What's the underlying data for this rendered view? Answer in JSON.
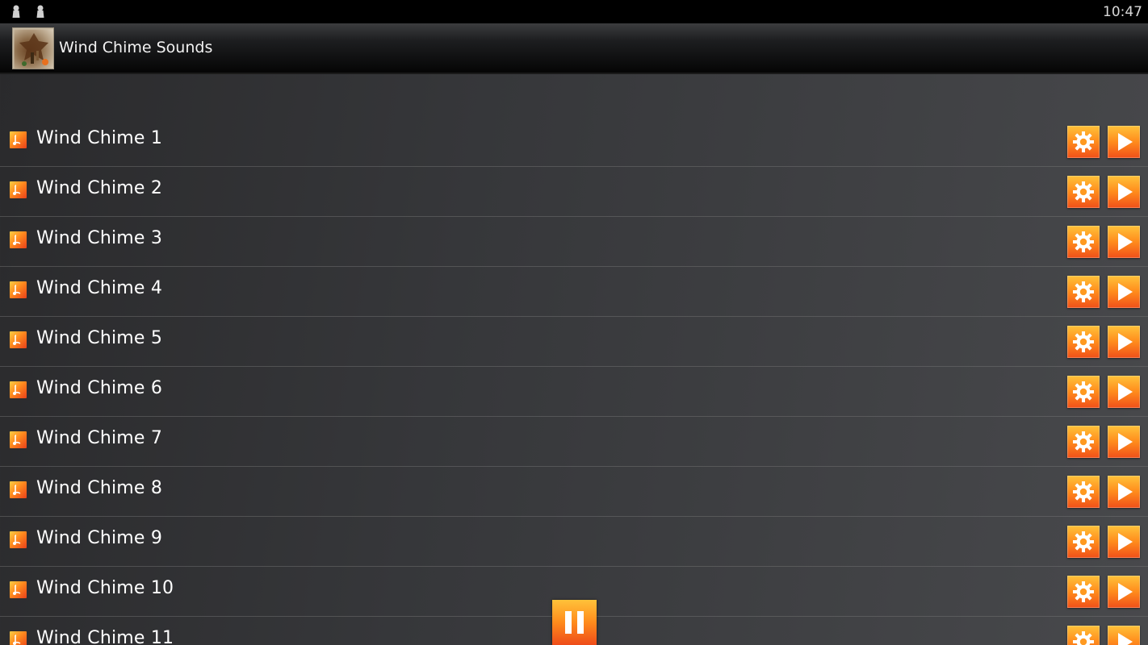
{
  "status_bar": {
    "time": "10:47",
    "notification_icons": [
      "android-icon",
      "android-icon"
    ]
  },
  "app_bar": {
    "title": "Wind Chime Sounds",
    "logo_icon": "wind-chime-logo-icon"
  },
  "list": {
    "items": [
      {
        "label": "Wind Chime 1"
      },
      {
        "label": "Wind Chime 2"
      },
      {
        "label": "Wind Chime 3"
      },
      {
        "label": "Wind Chime 4"
      },
      {
        "label": "Wind Chime 5"
      },
      {
        "label": "Wind Chime 6"
      },
      {
        "label": "Wind Chime 7"
      },
      {
        "label": "Wind Chime 8"
      },
      {
        "label": "Wind Chime 9"
      },
      {
        "label": "Wind Chime 10"
      },
      {
        "label": "Wind Chime 11"
      }
    ],
    "item_icon": "music-note-icon",
    "action_icons": [
      "gear-icon",
      "play-icon"
    ]
  },
  "player": {
    "control_icon": "pause-icon"
  },
  "colors": {
    "accent": "#ff8b1c",
    "accent_light": "#ffc23a",
    "accent_dark": "#f0501a",
    "background": "#36373a",
    "status_bar": "#000000"
  }
}
